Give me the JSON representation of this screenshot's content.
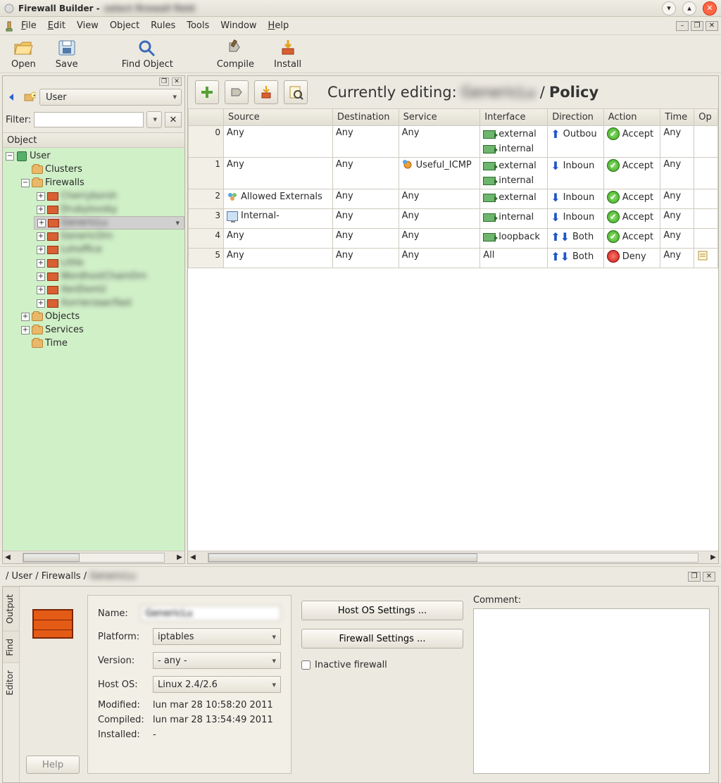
{
  "window": {
    "app": "Firewall Builder",
    "doc": "select firewall field"
  },
  "menubar": [
    "File",
    "Edit",
    "View",
    "Object",
    "Rules",
    "Tools",
    "Window",
    "Help"
  ],
  "toolbar": [
    {
      "id": "open",
      "label": "Open"
    },
    {
      "id": "save",
      "label": "Save"
    },
    {
      "id": "find",
      "label": "Find Object"
    },
    {
      "id": "compile",
      "label": "Compile"
    },
    {
      "id": "install",
      "label": "Install"
    }
  ],
  "left": {
    "library_selected": "User",
    "filter_label": "Filter:",
    "tree_header": "Object",
    "root_label": "User",
    "clusters": "Clusters",
    "firewalls": "Firewalls",
    "fw_items": [
      "Cherryborsh",
      "Drubylovsky",
      "GenericLu",
      "GenericOrn",
      "Lohoffice",
      "Little",
      "WordhostChainOrn",
      "XenDomU",
      "Xorrierzaar/fast"
    ],
    "selected_index": 2,
    "objects": "Objects",
    "services": "Services",
    "time": "Time"
  },
  "editing": {
    "prefix": "Currently editing:",
    "name": "GenericLu",
    "suffix": "Policy"
  },
  "columns": [
    "",
    "Source",
    "Destination",
    "Service",
    "Interface",
    "Direction",
    "Action",
    "Time",
    "Op"
  ],
  "rules": [
    {
      "n": 0,
      "source": "Any",
      "dest": "Any",
      "service": "Any",
      "ifaces": [
        "external",
        "internal"
      ],
      "dir": "Outbou",
      "act": "Accept",
      "time": "Any"
    },
    {
      "n": 1,
      "source": "Any",
      "dest": "Any",
      "service": "Useful_ICMP",
      "svc_icon": "icmp",
      "ifaces": [
        "external",
        "internal"
      ],
      "dir": "Inboun",
      "act": "Accept",
      "time": "Any"
    },
    {
      "n": 2,
      "source": "Allowed Externals",
      "src_icon": "group",
      "dest": "Any",
      "service": "Any",
      "ifaces": [
        "external"
      ],
      "dir": "Inboun",
      "act": "Accept",
      "time": "Any"
    },
    {
      "n": 3,
      "source": "Internal-",
      "src_icon": "host",
      "src_blur": true,
      "dest": "Any",
      "service": "Any",
      "ifaces": [
        "internal"
      ],
      "dir": "Inboun",
      "act": "Accept",
      "time": "Any"
    },
    {
      "n": 4,
      "source": "Any",
      "dest": "Any",
      "service": "Any",
      "ifaces": [
        "loopback"
      ],
      "dir": "Both",
      "act": "Accept",
      "time": "Any"
    },
    {
      "n": 5,
      "source": "Any",
      "dest": "Any",
      "service": "Any",
      "iface_text": "All",
      "dir": "Both",
      "act": "Deny",
      "time": "Any",
      "opt": true
    }
  ],
  "breadcrumb": {
    "path": "/ User / Firewalls /",
    "leaf": "GenericLu"
  },
  "tabs": [
    "Output",
    "Find",
    "Editor"
  ],
  "form": {
    "name_label": "Name:",
    "name_value": "GenericLu",
    "platform_label": "Platform:",
    "platform_value": "iptables",
    "version_label": "Version:",
    "version_value": "- any -",
    "hostos_label": "Host OS:",
    "hostos_value": "Linux 2.4/2.6",
    "modified_label": "Modified:",
    "modified_value": "lun mar 28 10:58:20 2011",
    "compiled_label": "Compiled:",
    "compiled_value": "lun mar 28 13:54:49 2011",
    "installed_label": "Installed:",
    "installed_value": "-",
    "host_btn": "Host OS Settings ...",
    "fw_btn": "Firewall Settings ...",
    "inactive": "Inactive firewall",
    "comment": "Comment:",
    "help": "Help"
  }
}
